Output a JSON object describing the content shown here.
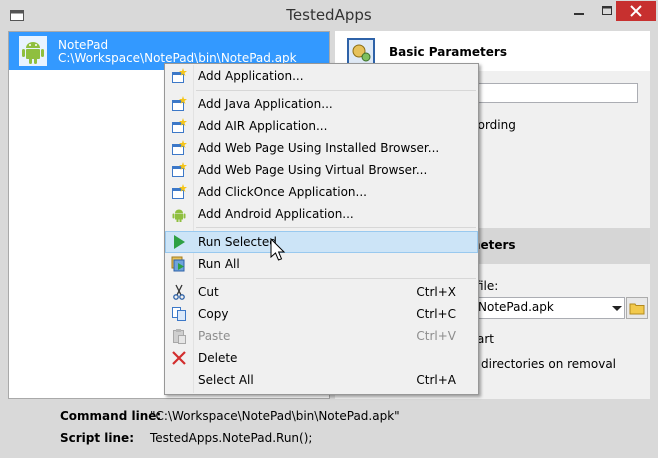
{
  "window": {
    "title": "TestedApps",
    "close_icon": "close-icon",
    "minimize_icon": "minimize-icon",
    "maximize_icon": "maximize-icon"
  },
  "app_list": {
    "items": [
      {
        "name": "NotePad",
        "path": "C:\\Workspace\\NotePad\\bin\\NotePad.apk",
        "icon": "android-icon"
      }
    ]
  },
  "right_panel": {
    "basic_title": "Basic Parameters",
    "recording_text": "cording",
    "params_title": "meters",
    "file_label": "file:",
    "apk_value": "NotePad.apk",
    "start_text": "art",
    "removal_text": "directories on removal"
  },
  "bottom": {
    "command_label": "Command line:",
    "command_value": "\"C:\\Workspace\\NotePad\\bin\\NotePad.apk\"",
    "script_label": "Script line:",
    "script_value": "TestedApps.NotePad.Run();"
  },
  "context_menu": {
    "items": [
      {
        "label": "Add Application...",
        "shortcut": "",
        "icon": "add-app-icon"
      },
      {
        "label": "Add Java Application...",
        "shortcut": "",
        "icon": "add-app-icon"
      },
      {
        "label": "Add AIR Application...",
        "shortcut": "",
        "icon": "add-app-icon"
      },
      {
        "label": "Add Web Page Using Installed Browser...",
        "shortcut": "",
        "icon": "add-app-icon"
      },
      {
        "label": "Add Web Page Using Virtual Browser...",
        "shortcut": "",
        "icon": "add-app-icon"
      },
      {
        "label": "Add ClickOnce Application...",
        "shortcut": "",
        "icon": "add-app-icon"
      },
      {
        "label": "Add Android Application...",
        "shortcut": "",
        "icon": "android-icon"
      },
      {
        "label": "Run Selected",
        "shortcut": "",
        "icon": "run-icon"
      },
      {
        "label": "Run All",
        "shortcut": "",
        "icon": "run-all-icon"
      },
      {
        "label": "Cut",
        "shortcut": "Ctrl+X",
        "icon": "cut-icon"
      },
      {
        "label": "Copy",
        "shortcut": "Ctrl+C",
        "icon": "copy-icon"
      },
      {
        "label": "Paste",
        "shortcut": "Ctrl+V",
        "icon": "paste-icon"
      },
      {
        "label": "Delete",
        "shortcut": "",
        "icon": "delete-icon"
      },
      {
        "label": "Select All",
        "shortcut": "Ctrl+A",
        "icon": ""
      }
    ]
  },
  "colors": {
    "selection": "#3399ff",
    "menu_hover": "#cce4f7",
    "close_button": "#c7302f"
  }
}
